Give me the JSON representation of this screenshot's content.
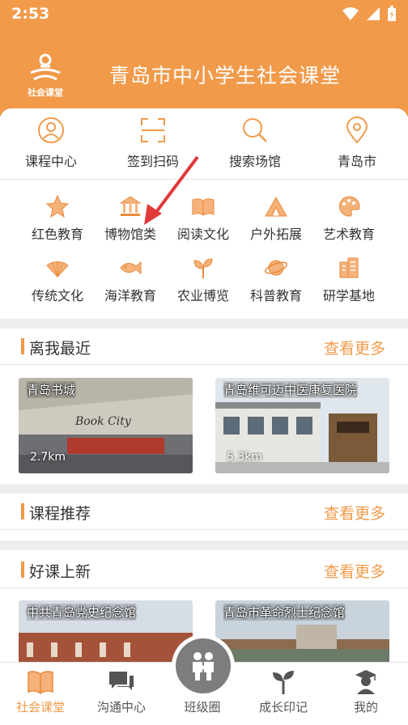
{
  "status": {
    "time": "2:53"
  },
  "header": {
    "title": "青岛市中小学生社会课堂",
    "logo_text": "社会课堂"
  },
  "quick": [
    {
      "label": "课程中心",
      "icon": "person-icon"
    },
    {
      "label": "签到扫码",
      "icon": "scan-icon"
    },
    {
      "label": "搜索场馆",
      "icon": "search-icon"
    },
    {
      "label": "青岛市",
      "icon": "location-icon"
    }
  ],
  "categories": [
    {
      "label": "红色教育",
      "icon": "star-icon"
    },
    {
      "label": "博物馆类",
      "icon": "museum-icon"
    },
    {
      "label": "阅读文化",
      "icon": "book-icon"
    },
    {
      "label": "户外拓展",
      "icon": "tent-icon"
    },
    {
      "label": "艺术教育",
      "icon": "palette-icon"
    },
    {
      "label": "传统文化",
      "icon": "fan-icon"
    },
    {
      "label": "海洋教育",
      "icon": "fish-icon"
    },
    {
      "label": "农业博览",
      "icon": "sprout-icon"
    },
    {
      "label": "科普教育",
      "icon": "planet-icon"
    },
    {
      "label": "研学基地",
      "icon": "building-icon"
    }
  ],
  "sections": {
    "nearby": {
      "title": "离我最近",
      "more": "查看更多"
    },
    "recommend": {
      "title": "课程推荐",
      "more": "查看更多"
    },
    "new": {
      "title": "好课上新",
      "more": "查看更多"
    }
  },
  "nearby_venues": [
    {
      "name": "青岛书城",
      "distance": "2.7km",
      "sign_text": "Book City"
    },
    {
      "name": "青岛维可迈中医康复医院",
      "distance": "5.3km"
    }
  ],
  "new_venues": [
    {
      "name": "中共青岛党史纪念馆"
    },
    {
      "name": "青岛市革命烈士纪念馆"
    }
  ],
  "nav": [
    {
      "label": "社会课堂",
      "active": true
    },
    {
      "label": "沟通中心"
    },
    {
      "label": "班级圈"
    },
    {
      "label": "成长印记"
    },
    {
      "label": "我的"
    }
  ],
  "colors": {
    "accent": "#f19a4a",
    "text": "#333333",
    "divider": "#eeeeee"
  }
}
